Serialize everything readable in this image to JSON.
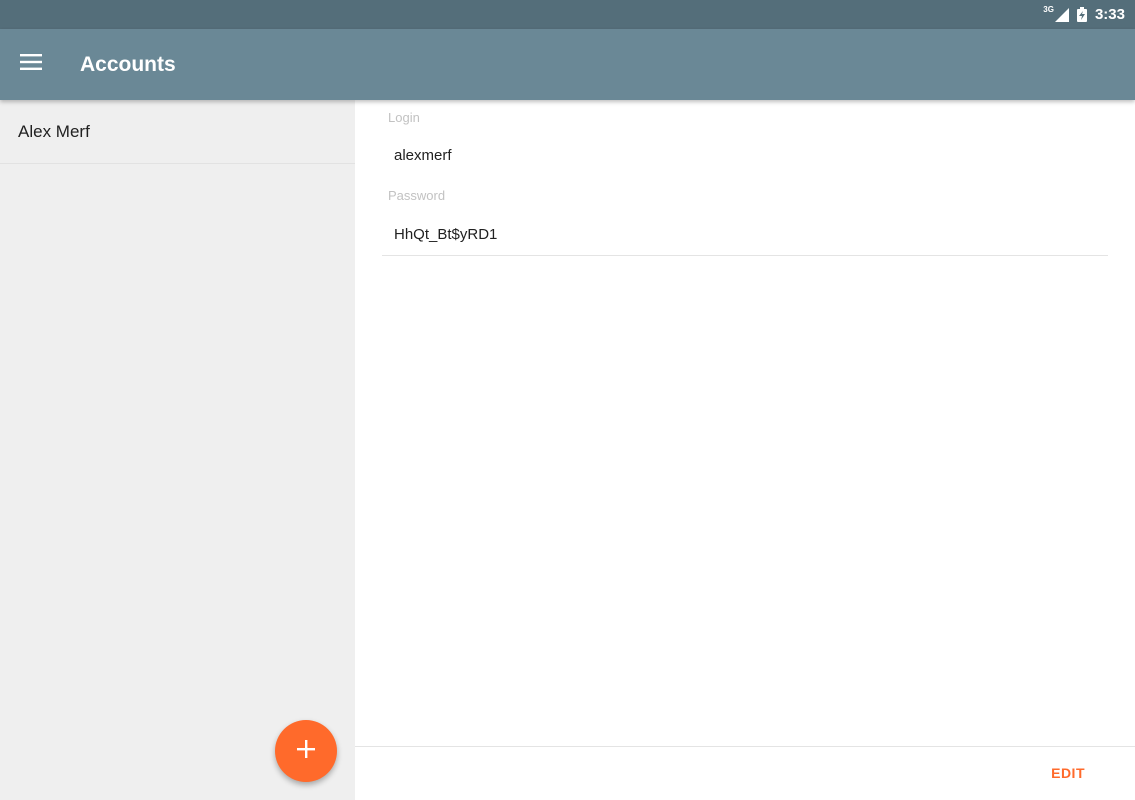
{
  "status_bar": {
    "network_label": "3G",
    "time": "3:33",
    "icons": [
      "signal-icon",
      "battery-icon"
    ]
  },
  "app_bar": {
    "title": "Accounts",
    "menu_icon": "menu-icon"
  },
  "accounts": [
    {
      "name": "Alex Merf"
    }
  ],
  "detail": {
    "login_label": "Login",
    "login_value": "alexmerf",
    "password_label": "Password",
    "password_value": "HhQt_Bt$yRD1",
    "edit_label": "EDIT"
  },
  "fab": {
    "icon": "plus-icon"
  },
  "colors": {
    "status_bar": "#546e7a",
    "app_bar": "#6a8896",
    "accent": "#ff6a2b",
    "sidebar_bg": "#efefef"
  }
}
